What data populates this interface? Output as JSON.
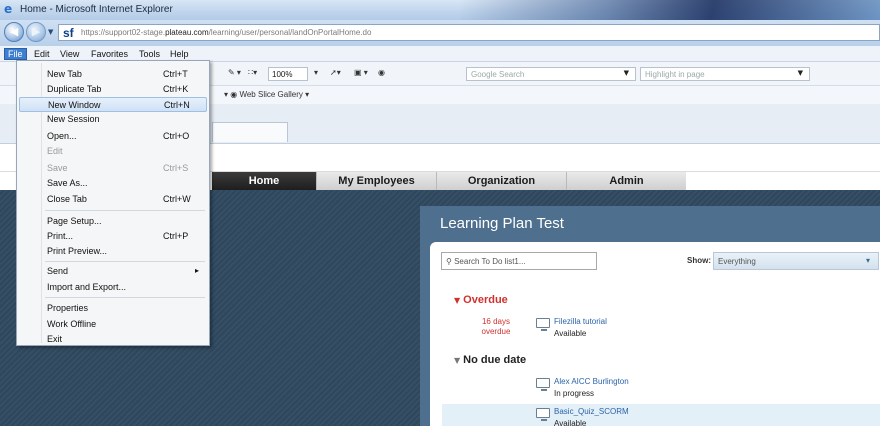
{
  "window": {
    "title": "Home - Microsoft Internet Explorer"
  },
  "address_bar": {
    "site_badge": "sf",
    "url_prefix": "https://support02-stage.",
    "url_domain": "plateau.com",
    "url_path": "/learning/user/personal/landOnPortalHome.do"
  },
  "menu_bar": {
    "items": [
      "File",
      "Edit",
      "View",
      "Favorites",
      "Tools",
      "Help"
    ]
  },
  "toolbar": {
    "zoom": "100%",
    "search_placeholder": "Google Search",
    "highlight_placeholder": "Highlight in page",
    "web_slice": "Web Slice Gallery"
  },
  "file_menu": {
    "items": [
      {
        "label": "New Tab",
        "shortcut": "Ctrl+T",
        "disabled": false
      },
      {
        "label": "Duplicate Tab",
        "shortcut": "Ctrl+K",
        "disabled": false
      },
      {
        "label": "New Window",
        "shortcut": "Ctrl+N",
        "disabled": false,
        "highlighted": true
      },
      {
        "label": "New Session",
        "shortcut": "",
        "disabled": false
      },
      {
        "label": "Open...",
        "shortcut": "Ctrl+O",
        "disabled": false
      },
      {
        "label": "Edit",
        "shortcut": "",
        "disabled": true
      },
      {
        "label": "Save",
        "shortcut": "Ctrl+S",
        "disabled": true
      },
      {
        "label": "Save As...",
        "shortcut": "",
        "disabled": false
      },
      {
        "label": "Close Tab",
        "shortcut": "Ctrl+W",
        "disabled": false
      },
      {
        "label": "Page Setup...",
        "shortcut": "",
        "disabled": false
      },
      {
        "label": "Print...",
        "shortcut": "Ctrl+P",
        "disabled": false
      },
      {
        "label": "Print Preview...",
        "shortcut": "",
        "disabled": false
      },
      {
        "label": "Send",
        "shortcut": "",
        "disabled": false,
        "submenu": true
      },
      {
        "label": "Import and Export...",
        "shortcut": "",
        "disabled": false
      },
      {
        "label": "Properties",
        "shortcut": "",
        "disabled": false
      },
      {
        "label": "Work Offline",
        "shortcut": "",
        "disabled": false
      },
      {
        "label": "Exit",
        "shortcut": "",
        "disabled": false
      }
    ]
  },
  "site_nav": {
    "tabs": [
      "Home",
      "My Employees",
      "Organization",
      "Admin"
    ],
    "active": "Home"
  },
  "learning_plan": {
    "title": "Learning Plan Test",
    "search_placeholder": "Search To Do list1...",
    "show_label": "Show:",
    "show_value": "Everything",
    "overdue_heading": "Overdue",
    "overdue_items": [
      {
        "days_line1": "16 days",
        "days_line2": "overdue",
        "title": "Filezilla tutorial",
        "status": "Available"
      }
    ],
    "no_due_heading": "No due date",
    "no_due_items": [
      {
        "title": "Alex AICC Burlington",
        "status": "In progress"
      },
      {
        "title": "Basic_Quiz_SCORM",
        "status": "Available"
      }
    ]
  },
  "colors": {
    "menu_active": "#3d7fd0",
    "overdue_red": "#d0312d",
    "link_blue": "#2b63a8",
    "panel_bg": "#4e6f8d",
    "page_dark": "#2f4960"
  }
}
